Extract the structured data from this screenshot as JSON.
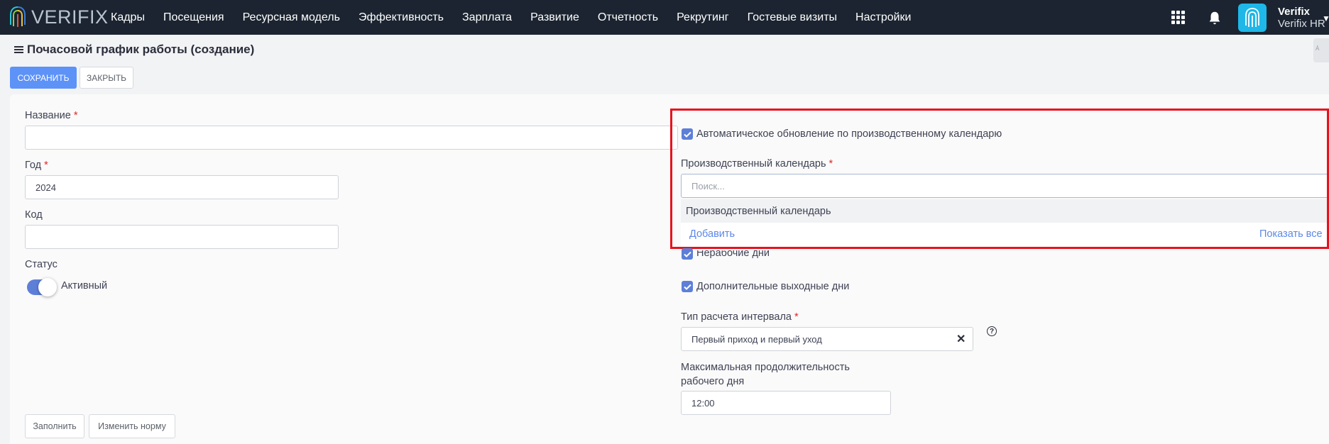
{
  "navbar": {
    "logo_text": "VERIFIX",
    "items": [
      "Кадры",
      "Посещения",
      "Ресурсная модель",
      "Эффективность",
      "Зарплата",
      "Развитие",
      "Отчетность",
      "Рекрутинг",
      "Гостевые визиты",
      "Настройки"
    ],
    "user_name": "Verifix",
    "user_org": "Verifix HR",
    "icons": [
      "apps-grid-icon",
      "bell-icon",
      "fingerprint-avatar-icon",
      "chevron-down-icon"
    ]
  },
  "page": {
    "title": "Почасовой график работы (создание)",
    "side_tab": "Á"
  },
  "toolbar": {
    "save_label": "СОХРАНИТЬ",
    "close_label": "ЗАКРЫТЬ"
  },
  "form": {
    "name_label": "Название",
    "name_value": "",
    "year_label": "Год",
    "year_value": "2024",
    "code_label": "Код",
    "code_value": "",
    "status_label": "Статус",
    "status_value": "Активный",
    "fill_label": "Заполнить",
    "change_norm_label": "Изменить норму",
    "required_mark": "*"
  },
  "right": {
    "auto_update_label": "Автоматическое обновление по производственному календарю",
    "calendar_label": "Производственный календарь",
    "search_placeholder": "Поиск...",
    "dropdown_item": "Производственный календарь",
    "add_link": "Добавить",
    "show_all_link": "Показать все",
    "nonworking_label": "Нерабочие дни",
    "extra_days_label": "Дополнительные выходные дни",
    "interval_type_label": "Тип расчета интервала",
    "interval_type_value": "Первый приход и первый уход",
    "max_duration_label_1": "Максимальная продолжительность",
    "max_duration_label_2": "рабочего дня",
    "max_duration_value": "12:00"
  },
  "colors": {
    "navbar": "#1b2430",
    "primary": "#5d92f7",
    "highlight": "#e8121d",
    "link": "#5d87e8"
  }
}
